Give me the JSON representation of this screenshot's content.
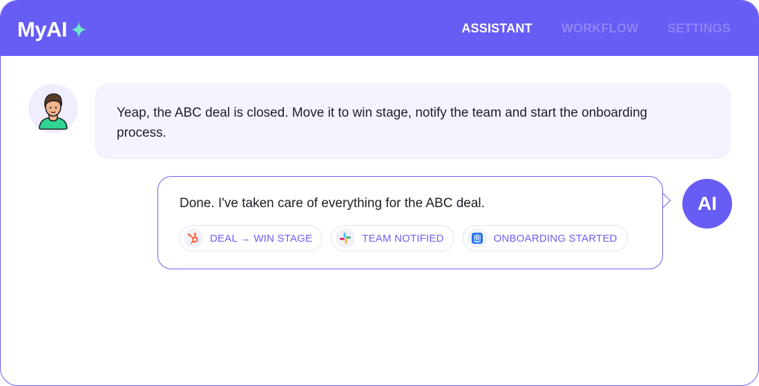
{
  "app": {
    "logo_text": "MyAI",
    "brand_color": "#675cf3",
    "spark_color": "#6ee9c9"
  },
  "nav": {
    "tabs": [
      {
        "label": "ASSISTANT",
        "active": true
      },
      {
        "label": "WORKFLOW",
        "active": false
      },
      {
        "label": "SETTINGS",
        "active": false
      }
    ]
  },
  "conversation": {
    "user_message": "Yeap, the ABC deal is closed. Move it to win stage, notify the team and start the onboarding process.",
    "ai_avatar_text": "AI",
    "ai_message": "Done. I've taken care of everything for the ABC deal.",
    "actions": [
      {
        "label": "DEAL → WIN STAGE",
        "icon": "hubspot-icon"
      },
      {
        "label": "TEAM NOTIFIED",
        "icon": "slack-icon"
      },
      {
        "label": "ONBOARDING STARTED",
        "icon": "intercom-icon"
      }
    ]
  }
}
